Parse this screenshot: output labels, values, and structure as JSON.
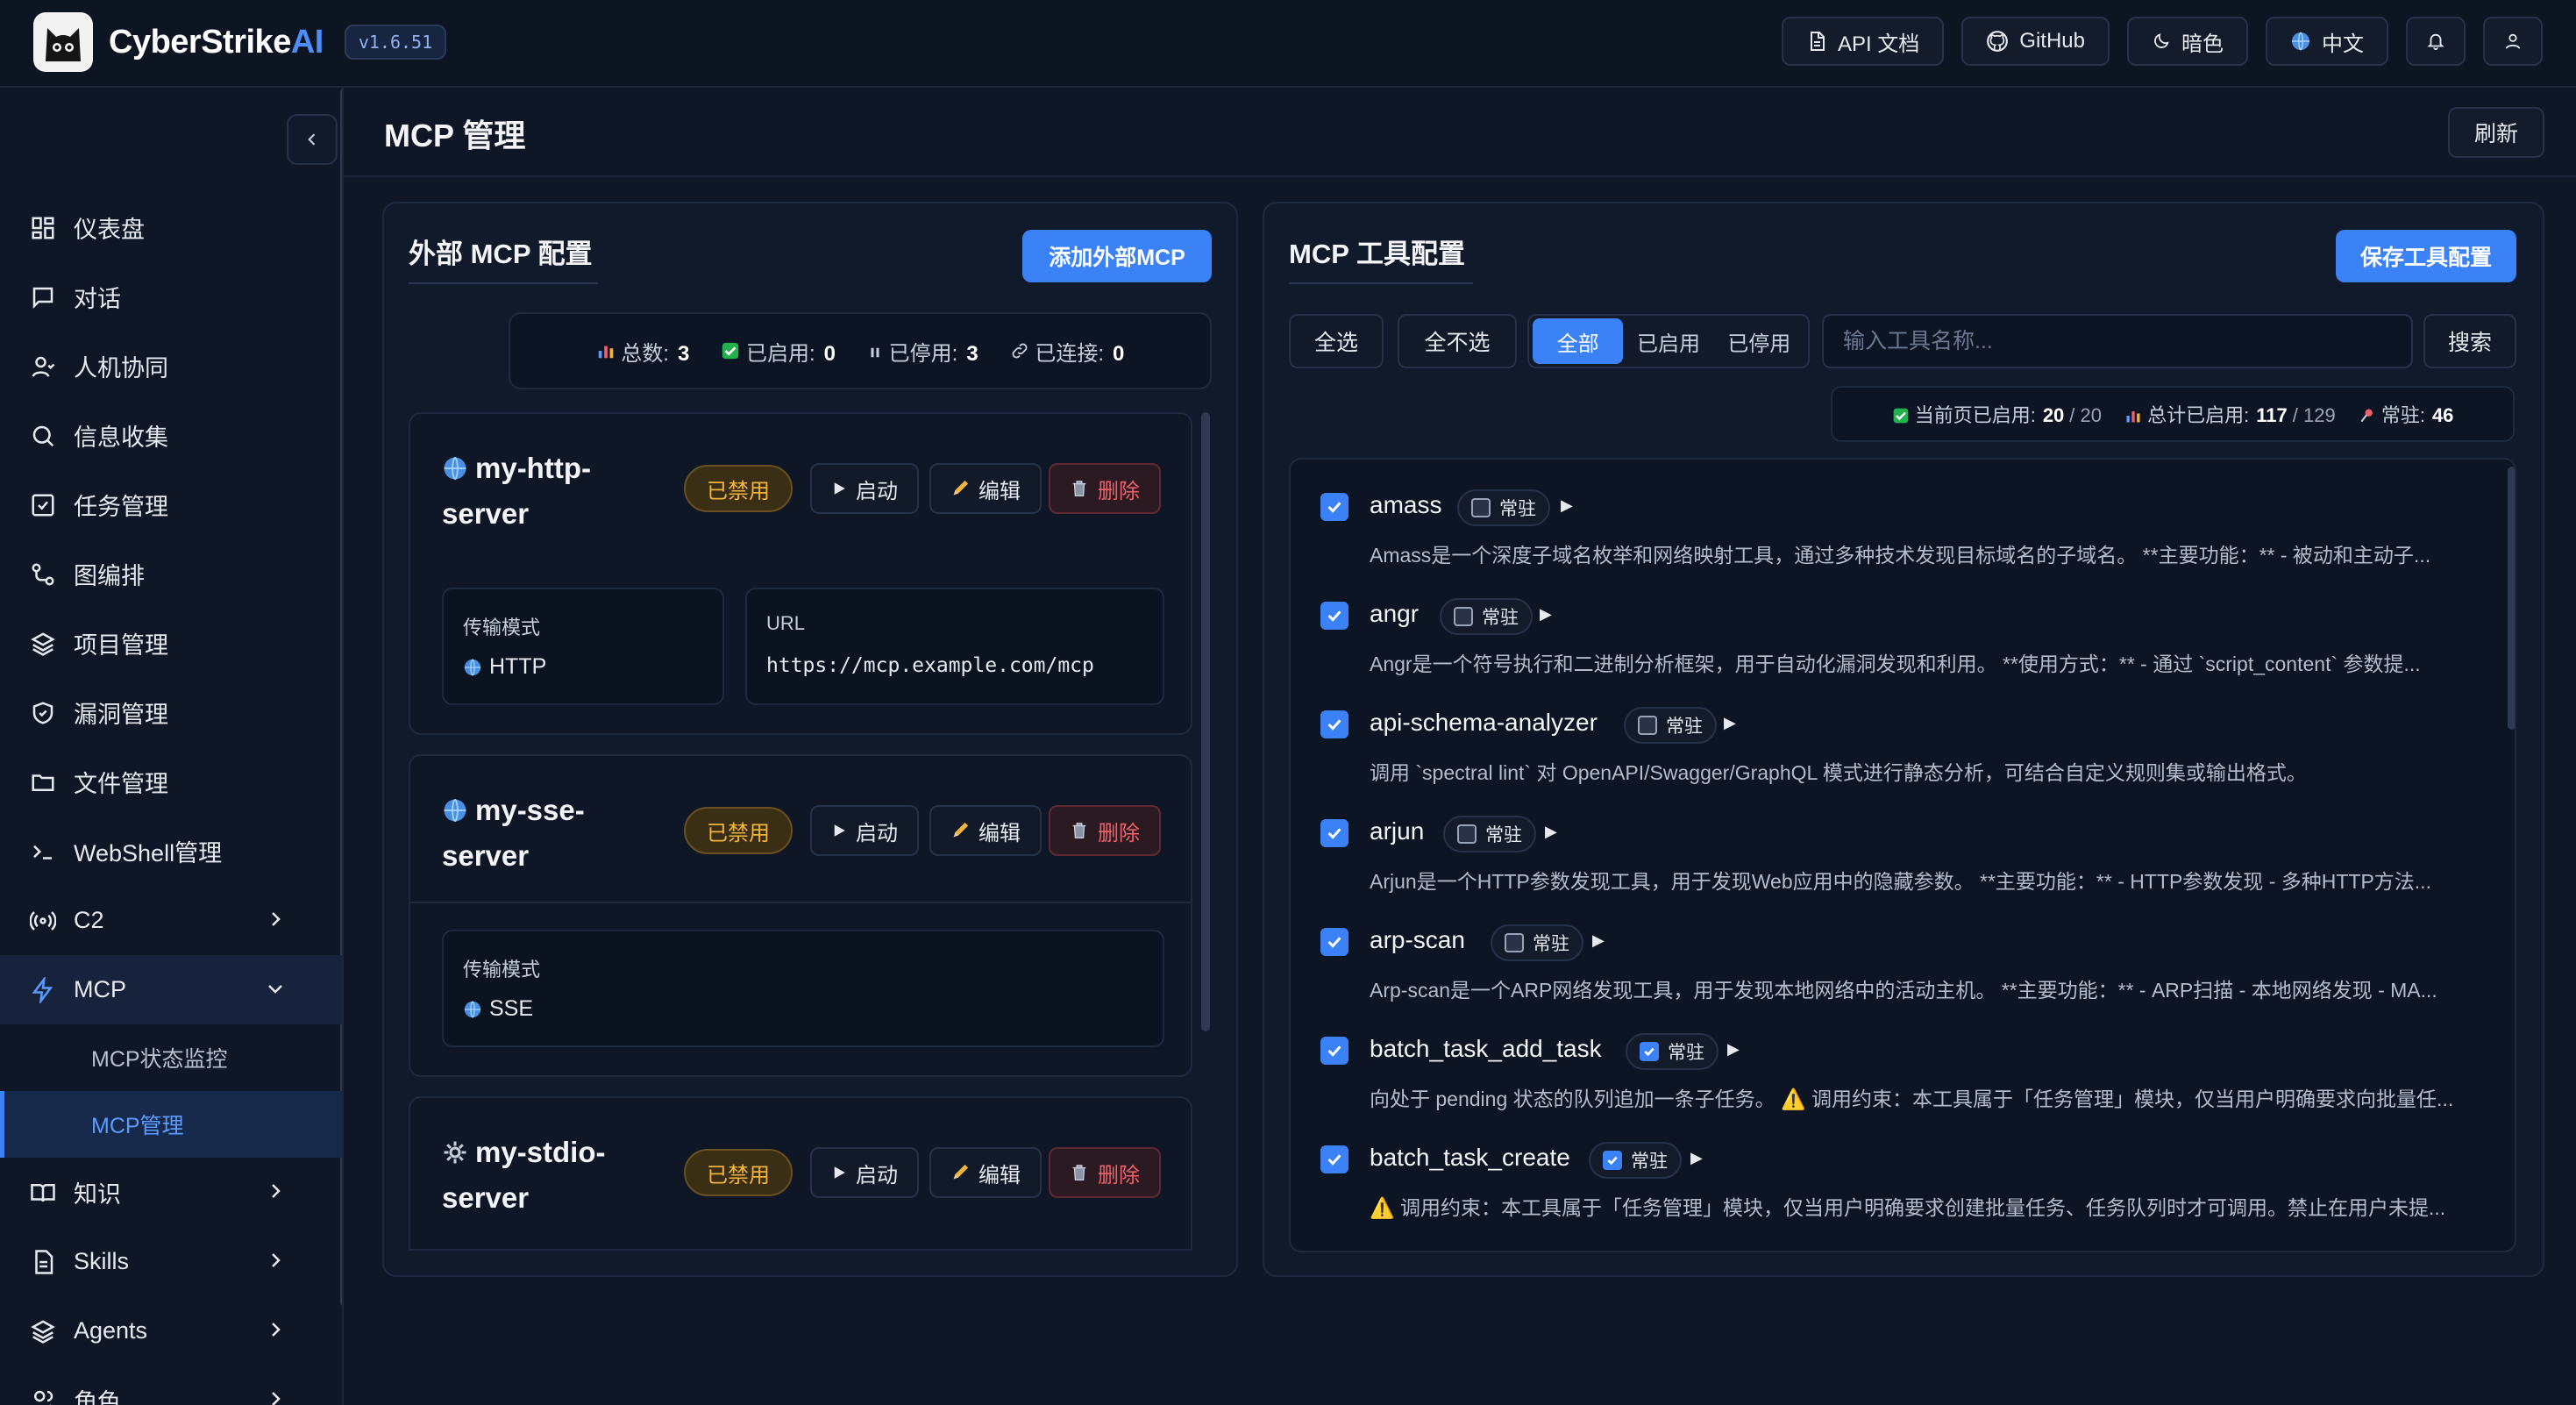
{
  "app": {
    "name_main": "CyberStrike",
    "name_accent": "AI",
    "version": "v1.6.51"
  },
  "topbar": {
    "api_docs": "API 文档",
    "github": "GitHub",
    "theme": "暗色",
    "language": "中文"
  },
  "sidebar": {
    "items": [
      {
        "label": "仪表盘",
        "icon": "dashboard-icon"
      },
      {
        "label": "对话",
        "icon": "chat-icon"
      },
      {
        "label": "人机协同",
        "icon": "user-icon"
      },
      {
        "label": "信息收集",
        "icon": "search-icon"
      },
      {
        "label": "任务管理",
        "icon": "task-check-icon"
      },
      {
        "label": "图编排",
        "icon": "graph-icon"
      },
      {
        "label": "项目管理",
        "icon": "layers-icon"
      },
      {
        "label": "漏洞管理",
        "icon": "shield-icon"
      },
      {
        "label": "文件管理",
        "icon": "folder-icon"
      },
      {
        "label": "WebShell管理",
        "icon": "terminal-icon"
      },
      {
        "label": "C2",
        "icon": "radio-icon"
      },
      {
        "label": "MCP",
        "icon": "bolt-icon"
      }
    ],
    "mcp_sub": [
      "MCP状态监控",
      "MCP管理"
    ],
    "items_after": [
      {
        "label": "知识",
        "icon": "book-icon"
      },
      {
        "label": "Skills",
        "icon": "document-icon"
      },
      {
        "label": "Agents",
        "icon": "layers-icon"
      },
      {
        "label": "角色",
        "icon": "users-icon"
      }
    ]
  },
  "page": {
    "title": "MCP 管理",
    "refresh": "刷新"
  },
  "external": {
    "title": "外部 MCP 配置",
    "add_button": "添加外部MCP",
    "stats": {
      "total_label": "总数:",
      "total": "3",
      "enabled_label": "已启用:",
      "enabled": "0",
      "stopped_label": "已停用:",
      "stopped": "3",
      "connected_label": "已连接:",
      "connected": "0"
    },
    "servers": [
      {
        "name_line1": "my-http-",
        "name_line2": "server",
        "status": "已禁用",
        "start": "启动",
        "edit": "编辑",
        "delete": "删除",
        "transport_label": "传输模式",
        "transport": "HTTP",
        "url_label": "URL",
        "url": "https://mcp.example.com/mcp"
      },
      {
        "name_line1": "my-sse-",
        "name_line2": "server",
        "status": "已禁用",
        "start": "启动",
        "edit": "编辑",
        "delete": "删除",
        "transport_label": "传输模式",
        "transport": "SSE"
      },
      {
        "name_line1": "my-stdio-",
        "name_line2": "server",
        "status": "已禁用",
        "start": "启动",
        "edit": "编辑",
        "delete": "删除"
      }
    ]
  },
  "tools": {
    "title": "MCP 工具配置",
    "save_button": "保存工具配置",
    "select_all": "全选",
    "select_none": "全不选",
    "filters": [
      "全部",
      "已启用",
      "已停用"
    ],
    "search_placeholder": "输入工具名称...",
    "search_button": "搜索",
    "stats": {
      "page_label": "当前页已启用:",
      "page_enabled": "20",
      "page_total": "/ 20",
      "all_label": "总计已启用:",
      "all_enabled": "117",
      "all_total": "/ 129",
      "pinned_label": "常驻:",
      "pinned": "46"
    },
    "pin_label": "常驻",
    "list": [
      {
        "name": "amass",
        "pinned": false,
        "desc": "Amass是一个深度子域名枚举和网络映射工具，通过多种技术发现目标域名的子域名。 **主要功能：** - 被动和主动子..."
      },
      {
        "name": "angr",
        "pinned": false,
        "desc": "Angr是一个符号执行和二进制分析框架，用于自动化漏洞发现和利用。 **使用方式：** - 通过 `script_content` 参数提..."
      },
      {
        "name": "api-schema-analyzer",
        "pinned": false,
        "desc": "调用 `spectral lint` 对 OpenAPI/Swagger/GraphQL 模式进行静态分析，可结合自定义规则集或输出格式。"
      },
      {
        "name": "arjun",
        "pinned": false,
        "desc": "Arjun是一个HTTP参数发现工具，用于发现Web应用中的隐藏参数。 **主要功能：** - HTTP参数发现 - 多种HTTP方法..."
      },
      {
        "name": "arp-scan",
        "pinned": false,
        "desc": "Arp-scan是一个ARP网络发现工具，用于发现本地网络中的活动主机。 **主要功能：** - ARP扫描 - 本地网络发现 - MA..."
      },
      {
        "name": "batch_task_add_task",
        "pinned": true,
        "desc": "向处于 pending 状态的队列追加一条子任务。 ⚠️ 调用约束：本工具属于「任务管理」模块，仅当用户明确要求向批量任..."
      },
      {
        "name": "batch_task_create",
        "pinned": true,
        "desc": "⚠️ 调用约束：本工具属于「任务管理」模块，仅当用户明确要求创建批量任务、任务队列时才可调用。禁止在用户未提..."
      }
    ]
  },
  "colors": {
    "accent": "#3b82f6",
    "warning": "#f1b43c",
    "danger": "#f0606a",
    "background": "#0f1626"
  }
}
